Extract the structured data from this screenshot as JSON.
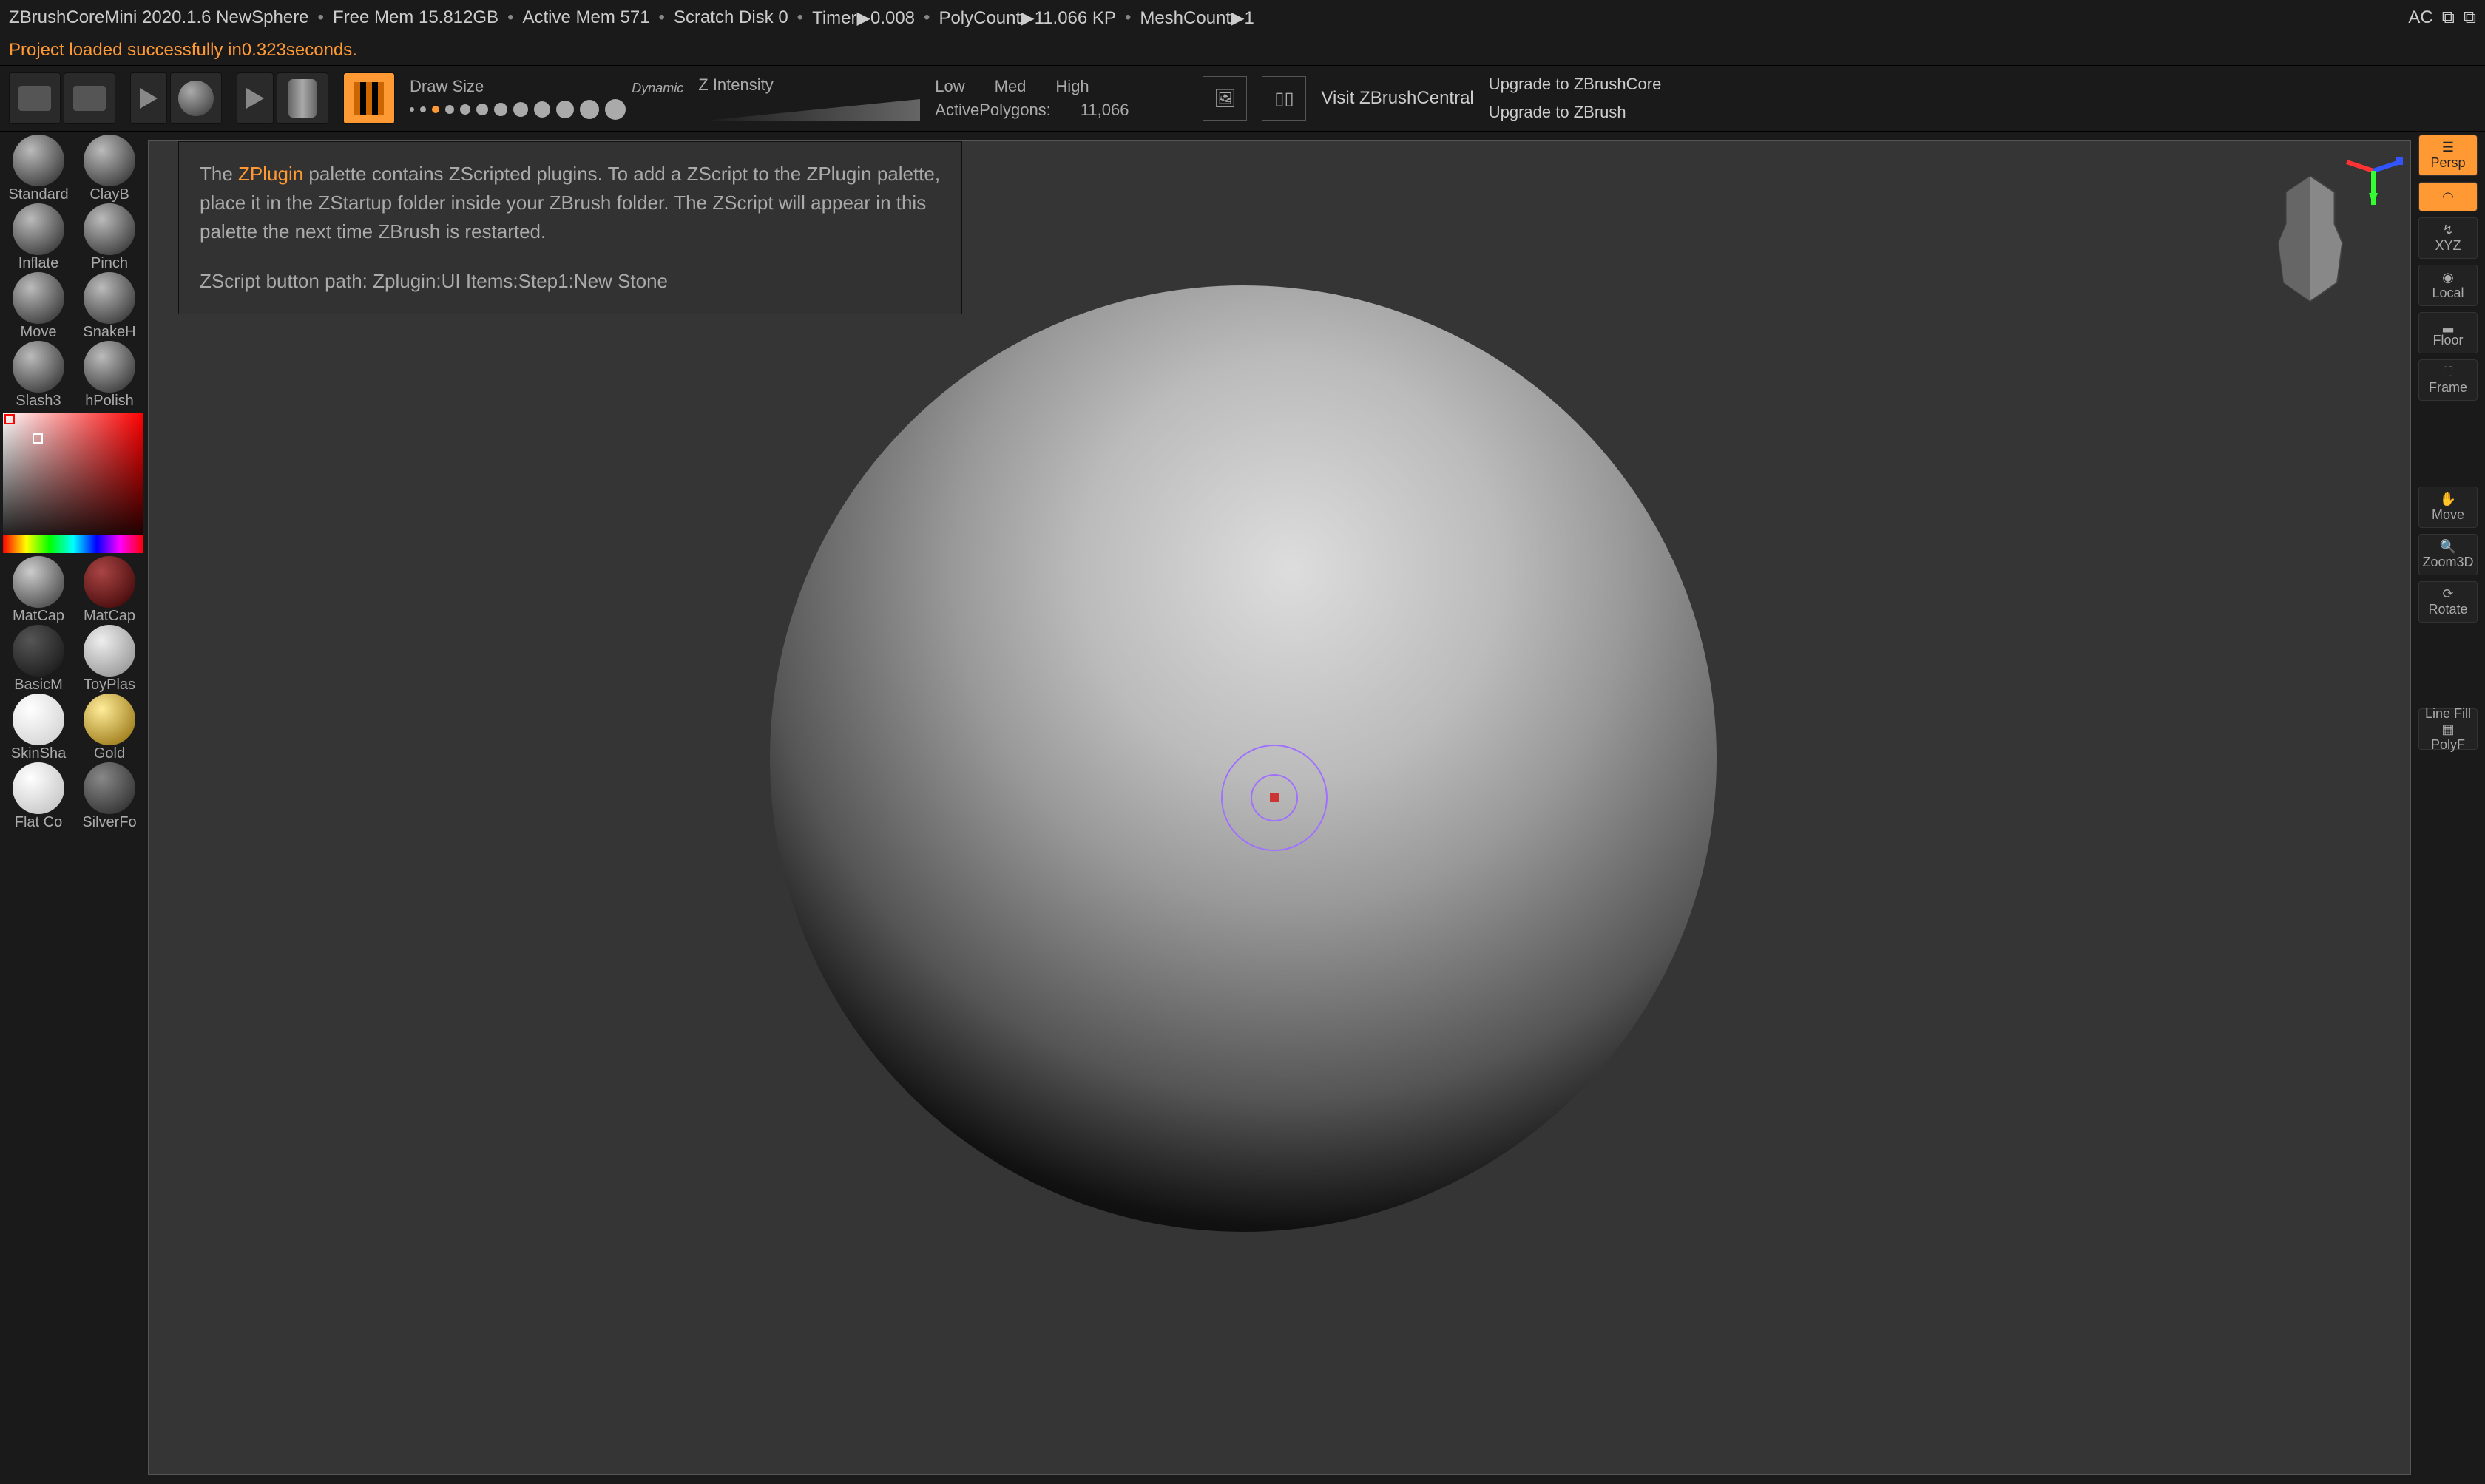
{
  "title": {
    "app": "ZBrushCoreMini 2020.1.6 NewSphere",
    "stats": [
      "Free Mem 15.812GB",
      "Active Mem 571",
      "Scratch Disk 0",
      "Timer▶0.008",
      "PolyCount▶11.066 KP",
      "MeshCount▶1"
    ],
    "right": "AC"
  },
  "status": {
    "prefix": "Project loaded successfully in ",
    "time": "0.323",
    "suffix": " seconds."
  },
  "toolbar": {
    "draw_size_label": "Draw Size",
    "dynamic_label": "Dynamic",
    "z_intensity_label": "Z Intensity",
    "poly_low": "Low",
    "poly_med": "Med",
    "poly_high": "High",
    "active_poly_label": "ActivePolygons:",
    "active_poly_value": "11,066",
    "central_link": "Visit ZBrushCentral",
    "upgrade_core": "Upgrade to ZBrushCore",
    "upgrade_full": "Upgrade to ZBrush"
  },
  "brushes": [
    [
      "Standard",
      "ClayB"
    ],
    [
      "Inflate",
      "Pinch"
    ],
    [
      "Move",
      "SnakeH"
    ],
    [
      "Slash3",
      "hPolish"
    ]
  ],
  "materials": [
    [
      "MatCap",
      "MatCap"
    ],
    [
      "BasicM",
      "ToyPlas"
    ],
    [
      "SkinSha",
      "Gold"
    ],
    [
      "Flat Co",
      "SilverFo"
    ]
  ],
  "tooltip": {
    "line1a": "The ",
    "line1b": "ZPlugin",
    "line1c": " palette contains ZScripted plugins. To add a ZScript to the ZPlugin palette, place it in the ZStartup folder inside your ZBrush folder. The ZScript will appear in this palette the next time ZBrush is restarted.",
    "line2": "ZScript button path: Zplugin:UI Items:Step1:New Stone"
  },
  "right_panel": {
    "persp": "Persp",
    "xyz": "XYZ",
    "local": "Local",
    "floor": "Floor",
    "frame": "Frame",
    "move": "Move",
    "zoom": "Zoom3D",
    "rotate": "Rotate",
    "linefill": "Line Fill",
    "polyf": "PolyF"
  }
}
